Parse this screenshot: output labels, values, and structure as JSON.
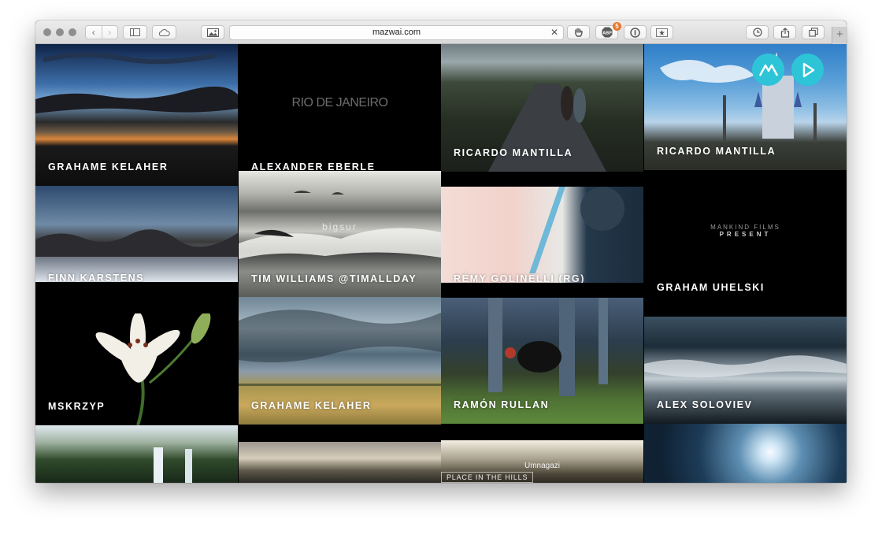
{
  "browser": {
    "url": "mazwai.com",
    "extension_badge_count": "5",
    "new_tab_label": "+",
    "icons": [
      "back-icon",
      "forward-icon",
      "sidebar-icon",
      "icloud-icon",
      "image-icon",
      "clear-icon",
      "hand-icon",
      "adblock-icon",
      "onepassword-icon",
      "star-icon",
      "history-icon",
      "share-icon",
      "tabs-icon"
    ]
  },
  "site": {
    "accent_color": "#2ec4d8",
    "controls": [
      "mazwai-logo-icon",
      "play-icon"
    ]
  },
  "tiles": [
    {
      "label": "GRAHAME KELAHER"
    },
    {
      "label": "ALEXANDER EBERLE",
      "overlay": "RIO DE JANEIRO"
    },
    {
      "label": "RICARDO MANTILLA"
    },
    {
      "label": "RICARDO MANTILLA"
    },
    {
      "label": "FINN KARSTENS"
    },
    {
      "label": "TIM WILLIAMS @TIMALLDAY",
      "overlay": "bigsur"
    },
    {
      "label": "RÉMY GOLINELLI (RG)"
    },
    {
      "label": "GRAHAM UHELSKI",
      "overlay": "MANKIND FILMS",
      "overlay2": "PRESENT"
    },
    {
      "label": "MSKRZYP"
    },
    {
      "label": "GRAHAME KELAHER"
    },
    {
      "label": "RAMÓN RULLAN"
    },
    {
      "label": "ALEX SOLOVIEV"
    },
    {
      "label": ""
    },
    {
      "label": ""
    },
    {
      "label": "",
      "overlay": "Umnagazi",
      "overlay2": "PLACE IN THE HILLS"
    },
    {
      "label": ""
    }
  ]
}
